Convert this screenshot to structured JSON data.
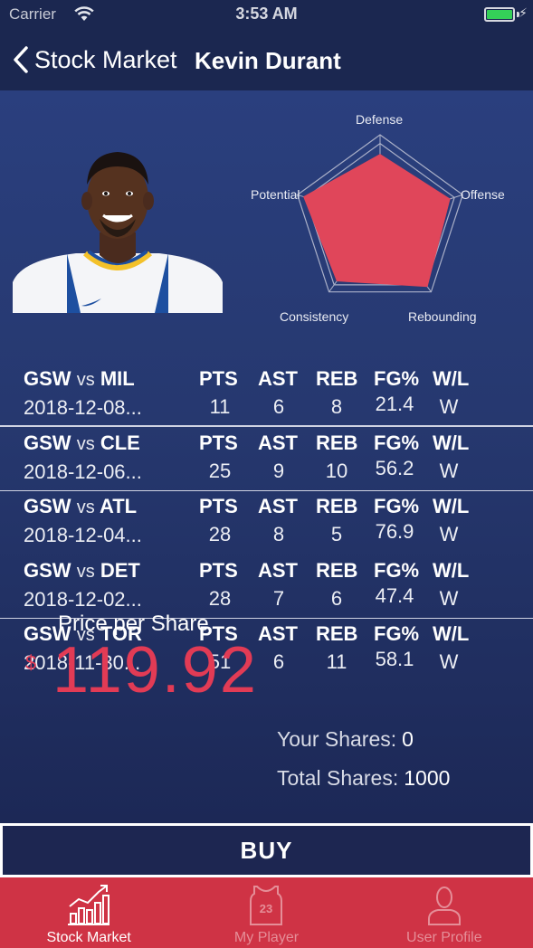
{
  "status_bar": {
    "carrier": "Carrier",
    "time": "3:53 AM",
    "battery_icon": "battery-charging-icon"
  },
  "nav": {
    "back_label": "Stock Market",
    "title": "Kevin Durant"
  },
  "radar": {
    "labels": {
      "defense": "Defense",
      "offense": "Offense",
      "rebounding": "Rebounding",
      "consistency": "Consistency",
      "potential": "Potential"
    },
    "values": {
      "defense": 0.78,
      "offense": 0.85,
      "rebounding": 0.93,
      "consistency": 0.85,
      "potential": 0.93
    },
    "fill_color": "#e0465a"
  },
  "games": [
    {
      "team": "GSW",
      "vs": "vs",
      "opponent": "MIL",
      "date": "2018-12-08...",
      "pts_label": "PTS",
      "ast_label": "AST",
      "reb_label": "REB",
      "fg_label": "FG%",
      "wl_label": "W/L",
      "pts": "11",
      "ast": "6",
      "reb": "8",
      "fg": "21.4",
      "wl": "W"
    },
    {
      "team": "GSW",
      "vs": "vs",
      "opponent": "CLE",
      "date": "2018-12-06...",
      "pts_label": "PTS",
      "ast_label": "AST",
      "reb_label": "REB",
      "fg_label": "FG%",
      "wl_label": "W/L",
      "pts": "25",
      "ast": "9",
      "reb": "10",
      "fg": "56.2",
      "wl": "W"
    },
    {
      "team": "GSW",
      "vs": "vs",
      "opponent": "ATL",
      "date": "2018-12-04...",
      "pts_label": "PTS",
      "ast_label": "AST",
      "reb_label": "REB",
      "fg_label": "FG%",
      "wl_label": "W/L",
      "pts": "28",
      "ast": "8",
      "reb": "5",
      "fg": "76.9",
      "wl": "W"
    },
    {
      "team": "GSW",
      "vs": "vs",
      "opponent": "DET",
      "date": "2018-12-02...",
      "pts_label": "PTS",
      "ast_label": "AST",
      "reb_label": "REB",
      "fg_label": "FG%",
      "wl_label": "W/L",
      "pts": "28",
      "ast": "7",
      "reb": "6",
      "fg": "47.4",
      "wl": "W"
    },
    {
      "team": "GSW",
      "vs": "vs",
      "opponent": "TOR",
      "date": "2018-11-30...",
      "pts_label": "PTS",
      "ast_label": "AST",
      "reb_label": "REB",
      "fg_label": "FG%",
      "wl_label": "W/L",
      "pts": "51",
      "ast": "6",
      "reb": "11",
      "fg": "58.1",
      "wl": "W"
    }
  ],
  "price": {
    "label": "Price per Share",
    "currency": "$",
    "value": "119.92",
    "color": "#e23b55"
  },
  "shares": {
    "yours_label": "Your Shares:",
    "yours_value": "0",
    "total_label": "Total Shares:",
    "total_value": "1000"
  },
  "buy_label": "BUY",
  "tabs": [
    {
      "label": "Stock Market",
      "icon": "bar-chart-icon",
      "active": true
    },
    {
      "label": "My Player",
      "icon": "jersey-icon",
      "active": false
    },
    {
      "label": "User Profile",
      "icon": "user-icon",
      "active": false
    }
  ]
}
